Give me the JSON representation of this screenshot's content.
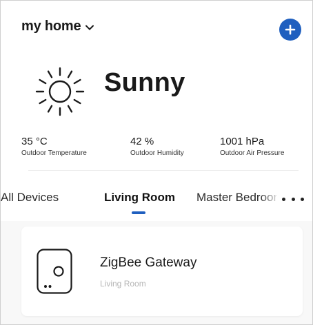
{
  "header": {
    "home_name": "my home",
    "icons": {
      "dropdown": "chevron-down-icon",
      "add": "plus-circle-icon"
    },
    "accent_color": "#1f5fbf"
  },
  "weather": {
    "condition": "Sunny",
    "icon": "sun-icon",
    "stats": [
      {
        "value": "35 °C",
        "label": "Outdoor Temperature"
      },
      {
        "value": "42 %",
        "label": "Outdoor Humidity"
      },
      {
        "value": "1001 hPa",
        "label": "Outdoor Air Pressure"
      }
    ]
  },
  "tabs": {
    "items": [
      {
        "label": "All Devices"
      },
      {
        "label": "Living Room",
        "active": true
      },
      {
        "label": "Master Bedroom"
      }
    ],
    "more_icon": "more-horizontal-icon"
  },
  "devices": [
    {
      "name": "ZigBee Gateway",
      "room": "Living Room",
      "icon": "gateway-icon"
    }
  ]
}
